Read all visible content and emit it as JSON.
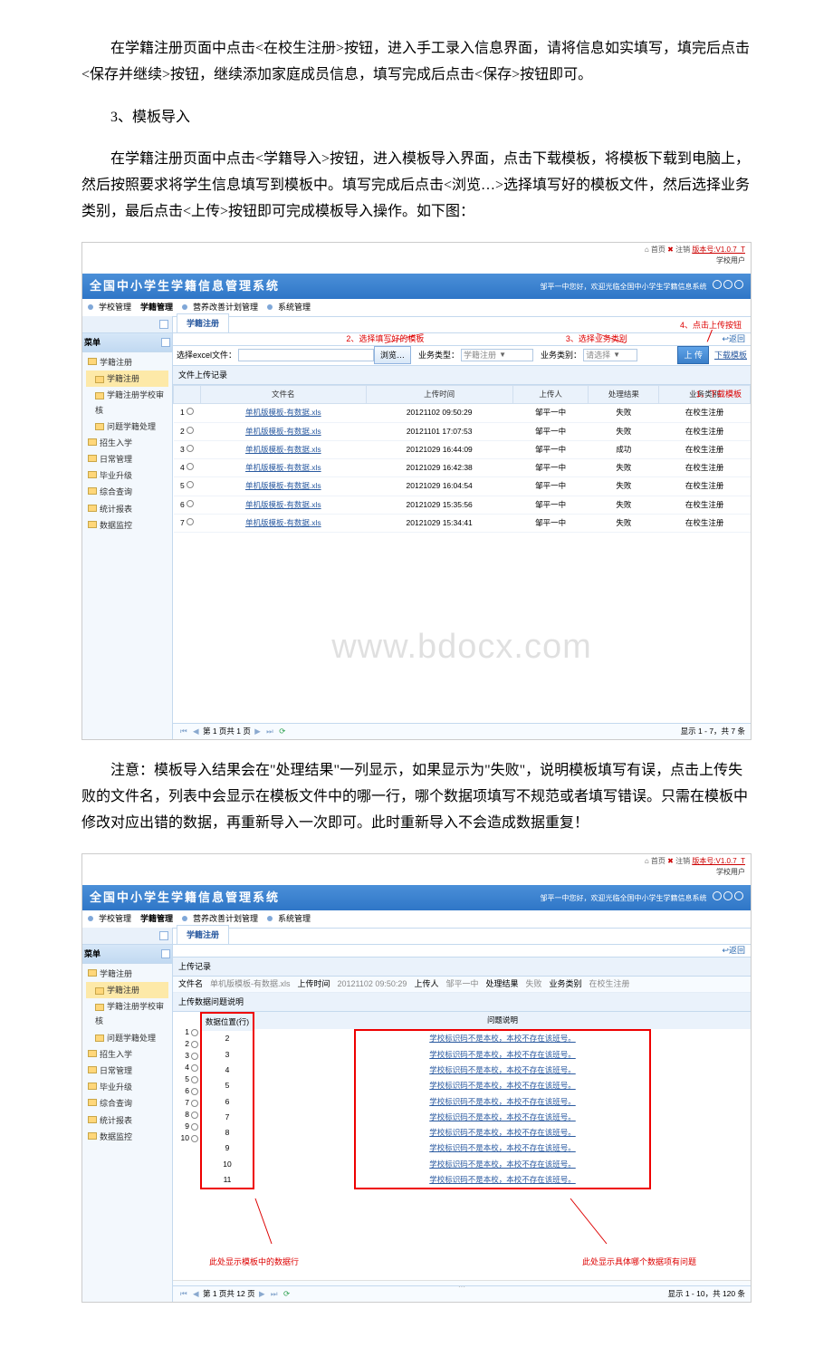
{
  "paragraphs": {
    "p1": "在学籍注册页面中点击<在校生注册>按钮，进入手工录入信息界面，请将信息如实填写，填完后点击<保存并继续>按钮，继续添加家庭成员信息，填写完成后点击<保存>按钮即可。",
    "p2": "3、模板导入",
    "p3": "在学籍注册页面中点击<学籍导入>按钮，进入模板导入界面，点击下载模板，将模板下载到电脑上，然后按照要求将学生信息填写到模板中。填写完成后点击<浏览…>选择填写好的模板文件，然后选择业务类别，最后点击<上传>按钮即可完成模板导入操作。如下图：",
    "p4": "注意：模板导入结果会在\"处理结果\"一列显示，如果显示为\"失败\"，说明模板填写有误，点击上传失败的文件名，列表中会显示在模板文件中的哪一行，哪个数据项填写不规范或者填写错误。只需在模板中修改对应出错的数据，再重新导入一次即可。此时重新导入不会造成数据重复！"
  },
  "app": {
    "systitle": "全国中小学生学籍信息管理系统",
    "toplinks": {
      "home": "首页",
      "logout": "注销",
      "version": "版本号:V1.0.7_T"
    },
    "schooluser": "学校用户",
    "welcome": "邹平一中您好，欢迎光临全国中小学生学籍信息系统",
    "menus": {
      "m1": "学校管理",
      "m2": "学籍管理",
      "m3": "营养改善计划管理",
      "m4": "系统管理"
    },
    "tab": "学籍注册",
    "back": "返回"
  },
  "sidebar": {
    "title": "菜单",
    "group1": "学籍注册",
    "items1": [
      "学籍注册",
      "学籍注册学校审核",
      "问题学籍处理"
    ],
    "folders": [
      "招生入学",
      "日常管理",
      "毕业升级",
      "综合查询",
      "统计报表",
      "数据监控"
    ]
  },
  "ss1": {
    "annot": {
      "a2": "2、选择填写好的模板",
      "a3": "3、选择业务类别",
      "a4": "4、点击上传按钮",
      "a1": "1、下载模板"
    },
    "toolbar": {
      "fileLabel": "选择excel文件：",
      "browse": "浏览…",
      "bizTypeLabel": "业务类型：",
      "bizTypeVal": "学籍注册",
      "bizCatLabel": "业务类别：",
      "bizCatVal": "请选择",
      "upload": "上 传",
      "download": "下载模板"
    },
    "section": "文件上传记录",
    "th": {
      "c1": "",
      "c2": "文件名",
      "c3": "上传时间",
      "c4": "上传人",
      "c5": "处理结果",
      "c6": "业务类别"
    },
    "rows": [
      {
        "n": "1",
        "file": "单机版模板-有数据.xls",
        "time": "20121102 09:50:29",
        "who": "邹平一中",
        "res": "失败",
        "cat": "在校生注册"
      },
      {
        "n": "2",
        "file": "单机版模板-有数据.xls",
        "time": "20121101 17:07:53",
        "who": "邹平一中",
        "res": "失败",
        "cat": "在校生注册"
      },
      {
        "n": "3",
        "file": "单机版模板-有数据.xls",
        "time": "20121029 16:44:09",
        "who": "邹平一中",
        "res": "成功",
        "cat": "在校生注册"
      },
      {
        "n": "4",
        "file": "单机版模板-有数据.xls",
        "time": "20121029 16:42:38",
        "who": "邹平一中",
        "res": "失败",
        "cat": "在校生注册"
      },
      {
        "n": "5",
        "file": "单机版模板-有数据.xls",
        "time": "20121029 16:04:54",
        "who": "邹平一中",
        "res": "失败",
        "cat": "在校生注册"
      },
      {
        "n": "6",
        "file": "单机版模板-有数据.xls",
        "time": "20121029 15:35:56",
        "who": "邹平一中",
        "res": "失败",
        "cat": "在校生注册"
      },
      {
        "n": "7",
        "file": "单机版模板-有数据.xls",
        "time": "20121029 15:34:41",
        "who": "邹平一中",
        "res": "失败",
        "cat": "在校生注册"
      }
    ],
    "pager": {
      "page": "第 1",
      "total": "页共 1 页",
      "summary": "显示 1 - 7，共 7 条"
    },
    "watermark": "www.bdocx.com"
  },
  "ss2": {
    "section1": "上传记录",
    "record": {
      "fileLbl": "文件名",
      "file": "单机版模板-有数据.xls",
      "timeLbl": "上传时间",
      "time": "20121102 09:50:29",
      "whoLbl": "上传人",
      "who": "邹平一中",
      "resLbl": "处理结果",
      "res": "失败",
      "catLbl": "业务类别",
      "cat": "在校生注册"
    },
    "section2": "上传数据问题说明",
    "col1": "数据位置(行)",
    "col2": "问题说明",
    "rows": [
      {
        "n": "1",
        "pos": "2",
        "msg": "学校标识码不是本校，本校不存在该班号。"
      },
      {
        "n": "2",
        "pos": "3",
        "msg": "学校标识码不是本校，本校不存在该班号。"
      },
      {
        "n": "3",
        "pos": "4",
        "msg": "学校标识码不是本校，本校不存在该班号。"
      },
      {
        "n": "4",
        "pos": "5",
        "msg": "学校标识码不是本校，本校不存在该班号。"
      },
      {
        "n": "5",
        "pos": "6",
        "msg": "学校标识码不是本校，本校不存在该班号。"
      },
      {
        "n": "6",
        "pos": "7",
        "msg": "学校标识码不是本校，本校不存在该班号。"
      },
      {
        "n": "7",
        "pos": "8",
        "msg": "学校标识码不是本校，本校不存在该班号。"
      },
      {
        "n": "8",
        "pos": "9",
        "msg": "学校标识码不是本校，本校不存在该班号。"
      },
      {
        "n": "9",
        "pos": "10",
        "msg": "学校标识码不是本校，本校不存在该班号。"
      },
      {
        "n": "10",
        "pos": "11",
        "msg": "学校标识码不是本校，本校不存在该班号。"
      }
    ],
    "callout1": "此处显示模板中的数据行",
    "callout2": "此处显示具体哪个数据项有问题",
    "pager": {
      "page": "第 1",
      "total": "页共 12 页",
      "summary": "显示 1 - 10，共 120 条"
    }
  }
}
